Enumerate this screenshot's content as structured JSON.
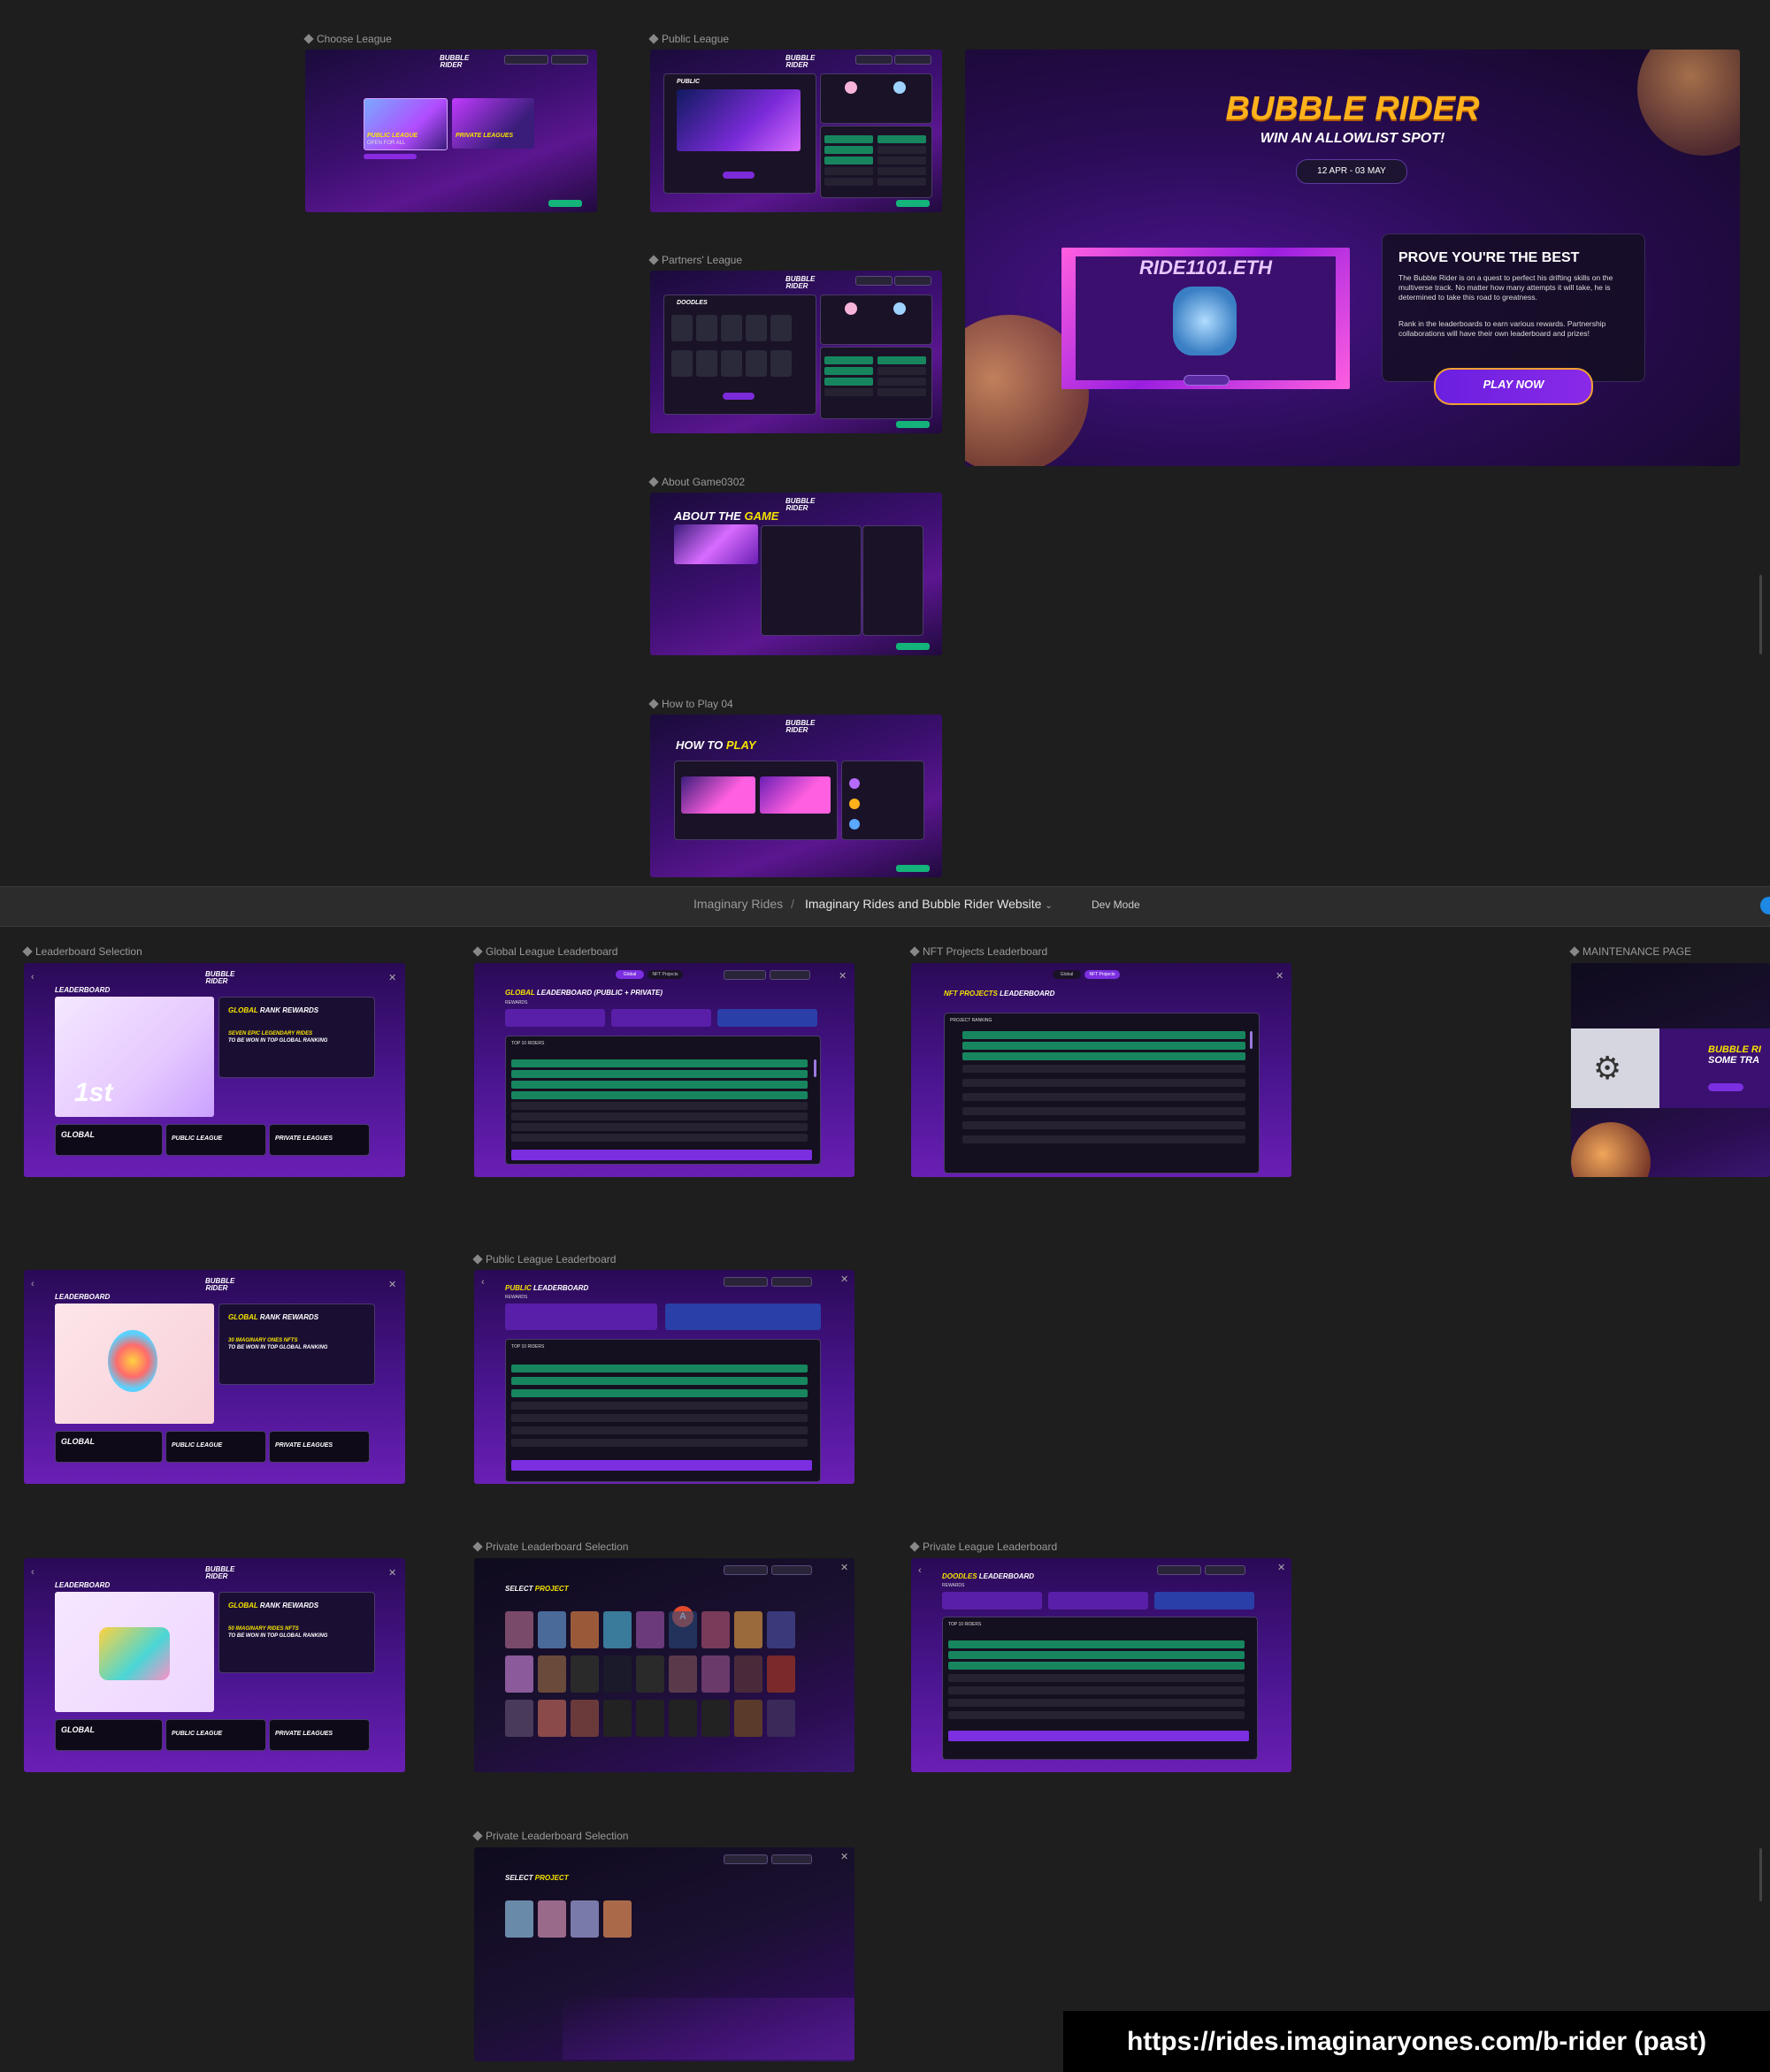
{
  "labels": {
    "choose_league": "Choose League",
    "public_league": "Public League",
    "partners_league": "Partners' League",
    "about_game": "About Game0302",
    "how_to_play": "How to Play 04",
    "leaderboard_selection": "Leaderboard Selection",
    "global_league_leaderboard": "Global League Leaderboard",
    "nft_projects_leaderboard": "NFT Projects Leaderboard",
    "maintenance_page": "MAINTENANCE PAGE",
    "public_league_leaderboard": "Public League Leaderboard",
    "private_leaderboard_selection": "Private Leaderboard Selection",
    "private_league_leaderboard": "Private League Leaderboard"
  },
  "breadcrumb": {
    "project": "Imaginary Rides",
    "separator": "/",
    "file": "Imaginary Rides and Bubble Rider Website",
    "mode": "Dev Mode"
  },
  "hero": {
    "title": "BUBBLE RIDER",
    "subtitle": "WIN AN ALLOWLIST SPOT!",
    "dates": "12 APR - 03 MAY",
    "banner": "RIDE1101.ETH",
    "heading": "PROVE YOU'RE THE BEST",
    "body1": "The Bubble Rider is on a quest to perfect his drifting skills on the multiverse track. No matter how many attempts it will take, he is determined to take this road to greatness.",
    "body2": "Rank in the leaderboards to earn various rewards. Partnership collaborations will have their own leaderboard and prizes!",
    "cta": "PLAY NOW"
  },
  "mini": {
    "logo": "BUBBLE RIDER",
    "public_league": "PUBLIC LEAGUE",
    "open_for_all": "OPEN FOR ALL",
    "private_leagues": "PRIVATE LEAGUES",
    "public": "PUBLIC",
    "doodles": "DOODLES",
    "about_the": "ABOUT THE",
    "game": "GAME",
    "how_to": "HOW TO",
    "play": "PLAY",
    "leaderboard": "LEADERBOARD",
    "global": "GLOBAL",
    "global_rank_rewards": "GLOBAL",
    "rank_rewards": "RANK REWARDS",
    "global_lb": "GLOBAL",
    "global_lb_rest": "LEADERBOARD (PUBLIC + PRIVATE)",
    "nft_projects": "NFT PROJECTS",
    "public_lb": "PUBLIC",
    "doodles_lb": "DOODLES",
    "select": "SELECT",
    "project": "PROJECT",
    "bubble_ri": "BUBBLE RI",
    "some_tra": "SOME TRA",
    "first": "1st",
    "top_riders": "TOP 10 RIDERS",
    "rewards": "REWARDS",
    "global_tab": "Global",
    "nft_tab": "NFT Projects",
    "project_ranking": "PROJECT RANKING",
    "seven_epic": "SEVEN EPIC LEGENDARY RIDES",
    "to_be_won": "TO BE WON IN TOP GLOBAL RANKING",
    "thirty_ones": "30 IMAGINARY ONES NFTS",
    "fifty_rides": "50 IMAGINARY RIDES NFTS"
  },
  "url": "https://rides.imaginaryones.com/b-rider (past)"
}
